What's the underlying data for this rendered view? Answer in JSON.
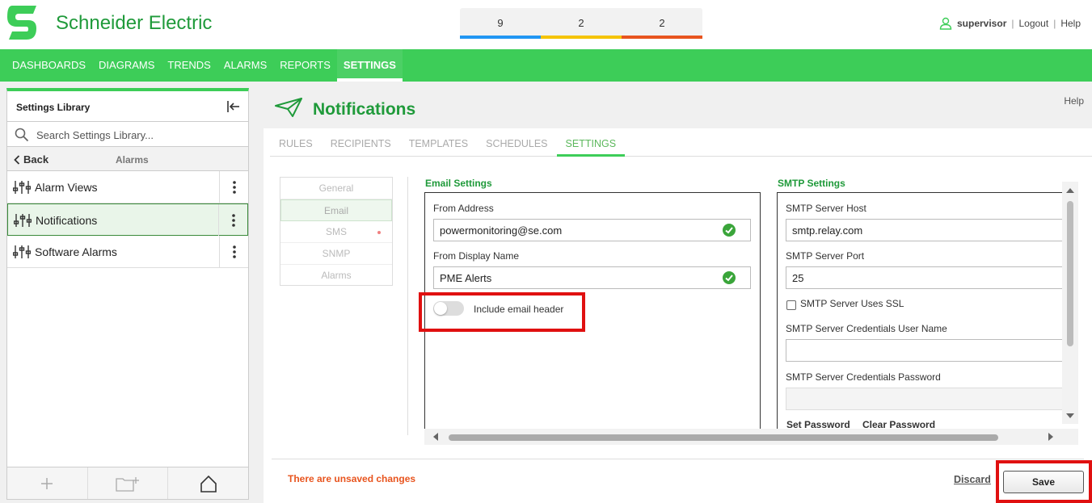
{
  "app": {
    "brand": "Schneider Electric"
  },
  "alarms": [
    {
      "count": "9",
      "color": "#2196f3"
    },
    {
      "count": "2",
      "color": "#f5c400"
    },
    {
      "count": "2",
      "color": "#e8541e"
    }
  ],
  "user": {
    "name": "supervisor",
    "logout": "Logout",
    "help": "Help"
  },
  "nav": [
    "DASHBOARDS",
    "DIAGRAMS",
    "TRENDS",
    "ALARMS",
    "REPORTS",
    "SETTINGS"
  ],
  "nav_active": "SETTINGS",
  "sidebar": {
    "title": "Settings Library",
    "search_placeholder": "Search Settings Library...",
    "back_label": "Back",
    "crumb": "Alarms",
    "items": [
      {
        "label": "Alarm Views"
      },
      {
        "label": "Notifications"
      },
      {
        "label": "Software Alarms"
      }
    ]
  },
  "page": {
    "title": "Notifications",
    "help": "Help",
    "tabs": [
      "RULES",
      "RECIPIENTS",
      "TEMPLATES",
      "SCHEDULES",
      "SETTINGS"
    ],
    "subnav": [
      "General",
      "Email",
      "SMS",
      "SNMP",
      "Alarms"
    ]
  },
  "email": {
    "section_title": "Email Settings",
    "from_address_label": "From Address",
    "from_address_value": "powermonitoring@se.com",
    "display_name_label": "From Display Name",
    "display_name_value": "PME Alerts",
    "include_header_label": "Include email header",
    "include_header_on": false
  },
  "smtp": {
    "section_title": "SMTP Settings",
    "host_label": "SMTP Server Host",
    "host_value": "smtp.relay.com",
    "port_label": "SMTP Server Port",
    "port_value": "25",
    "ssl_label": "SMTP Server Uses SSL",
    "user_label": "SMTP Server Credentials User Name",
    "user_value": "",
    "password_label": "SMTP Server Credentials Password",
    "set_password": "Set Password",
    "clear_password": "Clear Password"
  },
  "footer": {
    "unsaved": "There are unsaved changes",
    "discard": "Discard",
    "save": "Save"
  },
  "colors": {
    "brand_green": "#3dcd58",
    "title_green": "#1f9a3a",
    "warning": "#e8541e",
    "highlight": "#e01010"
  }
}
